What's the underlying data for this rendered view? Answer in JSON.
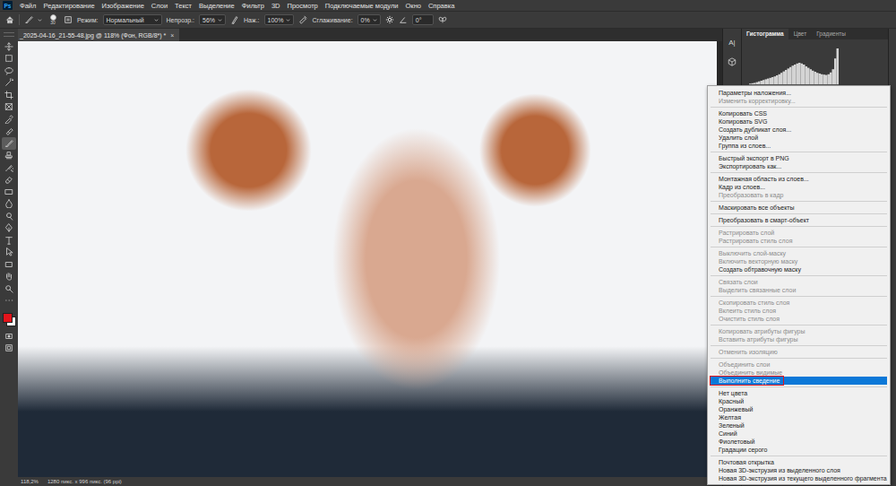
{
  "app": {
    "logo": "Ps"
  },
  "menu_bar": [
    "Файл",
    "Редактирование",
    "Изображение",
    "Слои",
    "Текст",
    "Выделение",
    "Фильтр",
    "3D",
    "Просмотр",
    "Подключаемые модули",
    "Окно",
    "Справка"
  ],
  "options_bar": {
    "brush_size": "30",
    "mode_label": "Режим:",
    "mode": "Нормальный",
    "opacity_label": "Непрозр.:",
    "opacity": "56%",
    "flow_label": "Наж.:",
    "flow": "100%",
    "smoothing_label": "Сглаживание:",
    "smoothing": "0%",
    "angle": "0°"
  },
  "document_tab": {
    "title": "_2025-04-16_21-55-48.jpg @ 118% (Фон, RGB/8*) *",
    "close": "×"
  },
  "tools": [
    {
      "kind": "move",
      "selected": false
    },
    {
      "kind": "marquee",
      "selected": false
    },
    {
      "kind": "lasso",
      "selected": false
    },
    {
      "kind": "wand",
      "selected": false
    },
    {
      "kind": "crop",
      "selected": false
    },
    {
      "kind": "frame",
      "selected": false
    },
    {
      "kind": "eyedropper",
      "selected": false
    },
    {
      "kind": "healing",
      "selected": false
    },
    {
      "kind": "brush",
      "selected": true
    },
    {
      "kind": "stamp",
      "selected": false
    },
    {
      "kind": "history",
      "selected": false
    },
    {
      "kind": "eraser",
      "selected": false
    },
    {
      "kind": "gradient",
      "selected": false
    },
    {
      "kind": "blur",
      "selected": false
    },
    {
      "kind": "dodge",
      "selected": false
    },
    {
      "kind": "pen",
      "selected": false
    },
    {
      "kind": "type",
      "selected": false
    },
    {
      "kind": "path",
      "selected": false
    },
    {
      "kind": "shape",
      "selected": false
    },
    {
      "kind": "hand",
      "selected": false
    },
    {
      "kind": "zoom",
      "selected": false
    },
    {
      "kind": "more",
      "selected": false
    }
  ],
  "colors": {
    "foreground": "#e3141b",
    "background": "#ffffff"
  },
  "panel_strip": [
    {
      "kind": "character",
      "label": "A|"
    },
    {
      "kind": "cube",
      "label": ""
    }
  ],
  "panel_tabs": [
    {
      "label": "Гистограмма",
      "selected": true
    },
    {
      "label": "Цвет",
      "selected": false
    },
    {
      "label": "Градиенты",
      "selected": false
    }
  ],
  "histogram": [
    2,
    3,
    4,
    6,
    8,
    10,
    12,
    14,
    16,
    18,
    20,
    22,
    25,
    28,
    32,
    36,
    40,
    44,
    48,
    52,
    55,
    58,
    60,
    58,
    55,
    50,
    46,
    42,
    38,
    35,
    32,
    30,
    28,
    27,
    26,
    28,
    33,
    42,
    72,
    100
  ],
  "context_menu": {
    "groups": [
      [
        {
          "label": "Параметры наложения...",
          "disabled": false,
          "selected": false
        },
        {
          "label": "Изменить корректировку...",
          "disabled": true,
          "selected": false
        }
      ],
      [
        {
          "label": "Копировать CSS",
          "disabled": false,
          "selected": false
        },
        {
          "label": "Копировать SVG",
          "disabled": false,
          "selected": false
        },
        {
          "label": "Создать дубликат слоя...",
          "disabled": false,
          "selected": false
        },
        {
          "label": "Удалить слой",
          "disabled": false,
          "selected": false
        },
        {
          "label": "Группа из слоев...",
          "disabled": false,
          "selected": false
        }
      ],
      [
        {
          "label": "Быстрый экспорт в PNG",
          "disabled": false,
          "selected": false
        },
        {
          "label": "Экспортировать как...",
          "disabled": false,
          "selected": false
        }
      ],
      [
        {
          "label": "Монтажная область из слоев...",
          "disabled": false,
          "selected": false
        },
        {
          "label": "Кадр из слоев...",
          "disabled": false,
          "selected": false
        },
        {
          "label": "Преобразовать в кадр",
          "disabled": true,
          "selected": false
        }
      ],
      [
        {
          "label": "Маскировать все объекты",
          "disabled": false,
          "selected": false
        }
      ],
      [
        {
          "label": "Преобразовать в смарт-объект",
          "disabled": false,
          "selected": false
        }
      ],
      [
        {
          "label": "Растрировать слой",
          "disabled": true,
          "selected": false
        },
        {
          "label": "Растрировать стиль слоя",
          "disabled": true,
          "selected": false
        }
      ],
      [
        {
          "label": "Выключить слой-маску",
          "disabled": true,
          "selected": false
        },
        {
          "label": "Включить векторную маску",
          "disabled": true,
          "selected": false
        },
        {
          "label": "Создать обтравочную маску",
          "disabled": false,
          "selected": false
        }
      ],
      [
        {
          "label": "Связать слои",
          "disabled": true,
          "selected": false
        },
        {
          "label": "Выделить связанные слои",
          "disabled": true,
          "selected": false
        }
      ],
      [
        {
          "label": "Скопировать стиль слоя",
          "disabled": true,
          "selected": false
        },
        {
          "label": "Вклеить стиль слоя",
          "disabled": true,
          "selected": false
        },
        {
          "label": "Очистить стиль слоя",
          "disabled": true,
          "selected": false
        }
      ],
      [
        {
          "label": "Копировать атрибуты фигуры",
          "disabled": true,
          "selected": false
        },
        {
          "label": "Вставить атрибуты фигуры",
          "disabled": true,
          "selected": false
        }
      ],
      [
        {
          "label": "Отменить изоляцию",
          "disabled": true,
          "selected": false
        }
      ],
      [
        {
          "label": "Объединить слои",
          "disabled": true,
          "selected": false
        },
        {
          "label": "Объединить видимые",
          "disabled": true,
          "selected": false
        },
        {
          "label": "Выполнить сведение",
          "disabled": false,
          "selected": true
        }
      ],
      [
        {
          "label": "Нет цвета",
          "disabled": false,
          "selected": false
        },
        {
          "label": "Красный",
          "disabled": false,
          "selected": false
        },
        {
          "label": "Оранжевый",
          "disabled": false,
          "selected": false
        },
        {
          "label": "Желтая",
          "disabled": false,
          "selected": false
        },
        {
          "label": "Зеленый",
          "disabled": false,
          "selected": false
        },
        {
          "label": "Синий",
          "disabled": false,
          "selected": false
        },
        {
          "label": "Фиолетовый",
          "disabled": false,
          "selected": false
        },
        {
          "label": "Градации серого",
          "disabled": false,
          "selected": false
        }
      ],
      [
        {
          "label": "Почтовая открытка",
          "disabled": false,
          "selected": false
        },
        {
          "label": "Новая 3D-экструзия из выделенного слоя",
          "disabled": false,
          "selected": false
        },
        {
          "label": "Новая 3D-экструзия из текущего выделенного фрагмента",
          "disabled": false,
          "selected": false
        }
      ]
    ]
  },
  "status_bar": {
    "zoom": "118,2%",
    "size": "1280 пикс. x 996 пикс. (96 ppi)"
  }
}
